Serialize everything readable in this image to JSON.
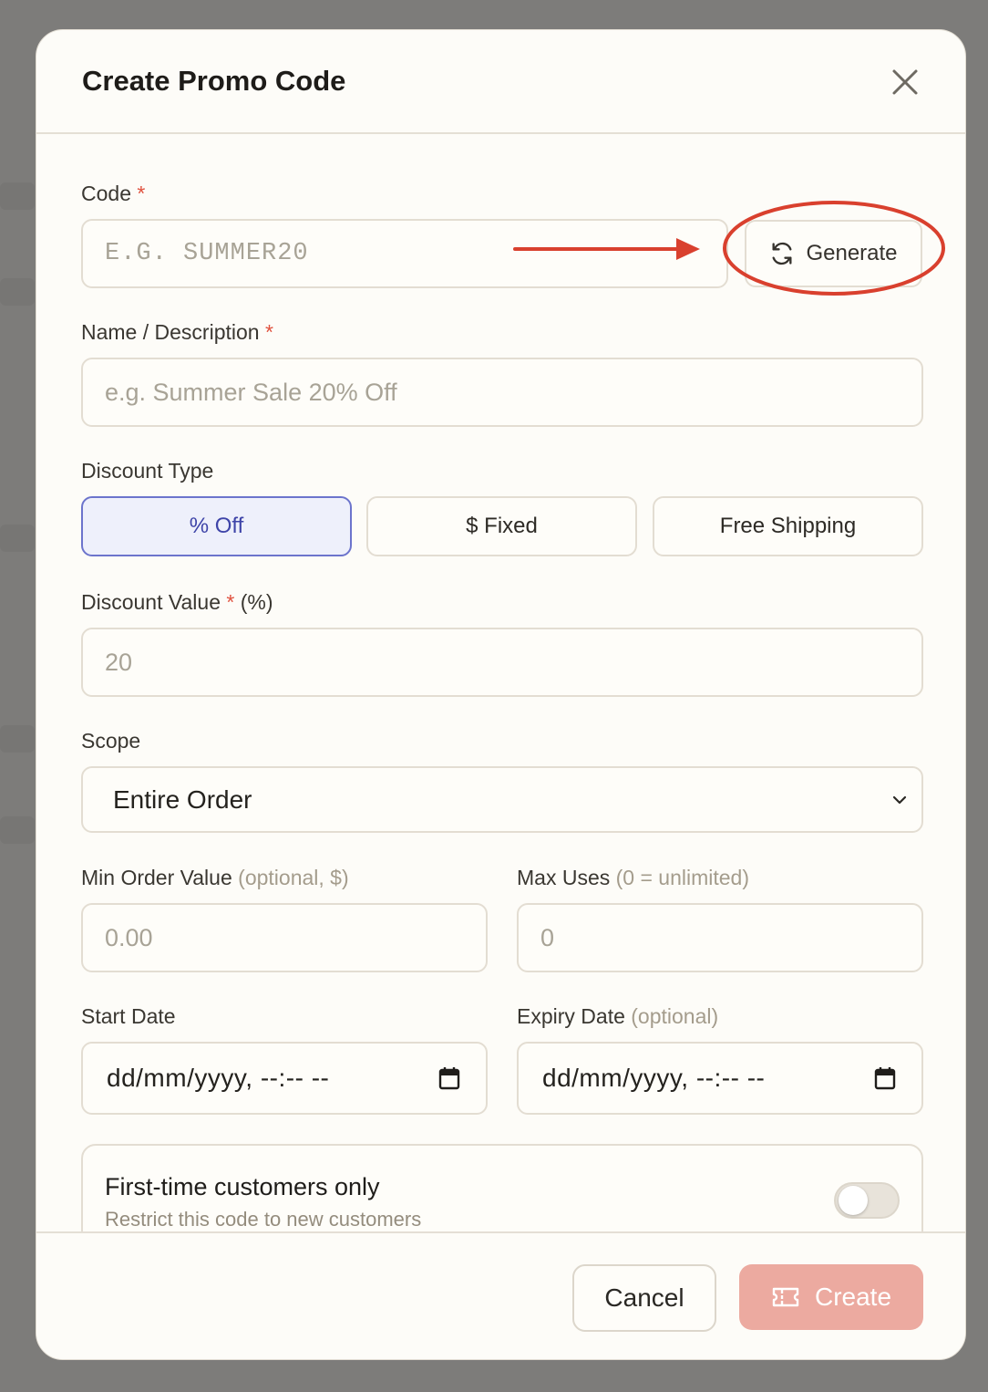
{
  "modal": {
    "title": "Create Promo Code"
  },
  "form": {
    "code": {
      "label": "Code",
      "required_mark": "*",
      "placeholder": "E.G. SUMMER20",
      "generate_label": "Generate"
    },
    "name": {
      "label": "Name / Description",
      "required_mark": "*",
      "placeholder": "e.g. Summer Sale 20% Off"
    },
    "discount_type": {
      "label": "Discount Type",
      "options": [
        "% Off",
        "$ Fixed",
        "Free Shipping"
      ],
      "selected": "% Off"
    },
    "discount_value": {
      "label": "Discount Value",
      "required_mark": "*",
      "unit": "(%)",
      "placeholder": "20"
    },
    "scope": {
      "label": "Scope",
      "selected": "Entire Order"
    },
    "min_order": {
      "label": "Min Order Value",
      "hint": "(optional, $)",
      "placeholder": "0.00"
    },
    "max_uses": {
      "label": "Max Uses",
      "hint": "(0 = unlimited)",
      "placeholder": "0"
    },
    "start_date": {
      "label": "Start Date",
      "value": "dd/mm/yyyy, --:-- --"
    },
    "expiry_date": {
      "label": "Expiry Date",
      "hint": "(optional)",
      "value": "dd/mm/yyyy, --:-- --"
    },
    "first_time": {
      "title": "First-time customers only",
      "subtitle": "Restrict this code to new customers",
      "enabled": false
    }
  },
  "footer": {
    "cancel_label": "Cancel",
    "create_label": "Create"
  },
  "colors": {
    "accent": "#6c74cc",
    "danger": "#e0523f",
    "create_disabled": "#ecaaa0",
    "annotation": "#d9402e"
  },
  "icons": {
    "close": "close-icon",
    "generate": "refresh-icon",
    "select": "chevron-down-icon",
    "calendar": "calendar-icon",
    "create": "ticket-icon"
  }
}
